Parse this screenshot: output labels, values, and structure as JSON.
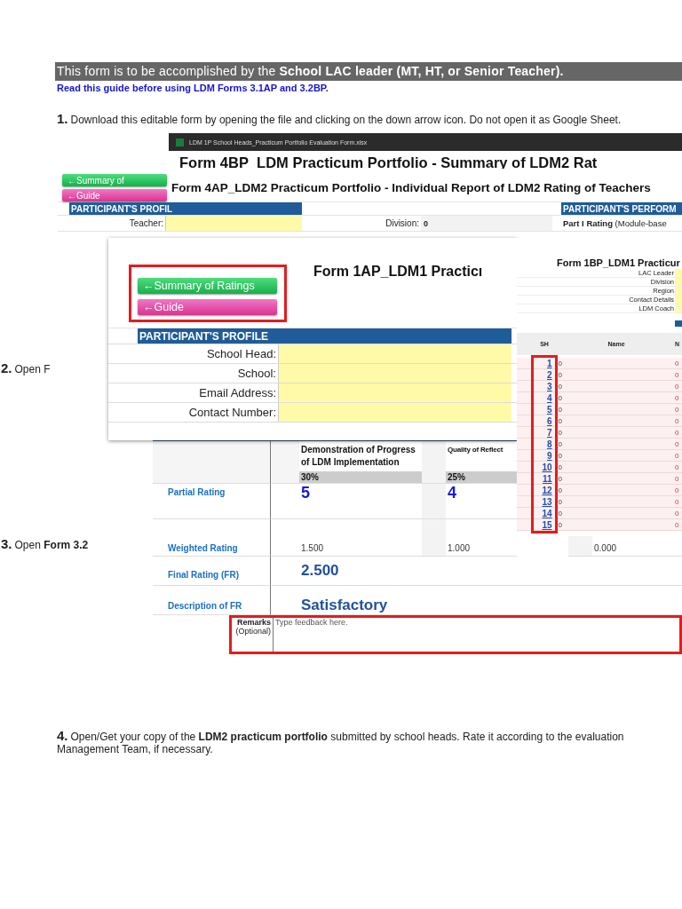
{
  "header": {
    "text": "This form is to be accomplished by the **School LAC leader (MT, HT, or Senior Teacher).**"
  },
  "guide_note": "Read this guide before using LDM Forms 3.1AP and 3.2BP.",
  "steps": [
    {
      "number": "1.",
      "text": "Download this editable form by opening the file and clicking on the down arrow icon. Do not open it as Google Sheet."
    },
    {
      "number": "2.",
      "text": "Open F"
    },
    {
      "number": "3.",
      "text": "Open **Form 3.2**"
    },
    {
      "number": "4.",
      "text": "Open/Get your copy of the **LDM2 practicum portfolio** submitted by school heads. Rate it according to the evaluation Management Team, if necessary."
    }
  ],
  "excel_window": {
    "file_name": "LDM 1P School Heads_Practicum Portfolio Evaluation Form.xlsx",
    "title": "Form 4BP_LDM Practicum Portfolio - Summary of LDM2 Rat"
  },
  "form_4ap": {
    "buttons": [
      {
        "label": "←Summary of",
        "kind": "summary"
      },
      {
        "label": "←Guide",
        "kind": "guide"
      }
    ],
    "title": "Form 4AP_LDM2 Practicum Portfolio - Individual Report of LDM2 Rating of Teachers",
    "profile_header": "PARTICIPANT'S PROFIL",
    "performance_header": "PARTICIPANT'S PERFORM",
    "rows": [
      {
        "label": "Teacher:",
        "info_label": "Division:",
        "info_value": "0",
        "performance": "**Part I Rating** (Module-base"
      }
    ]
  },
  "form_1ap": {
    "buttons": [
      {
        "label": "←Summary of Ratings",
        "kind": "summary"
      },
      {
        "label": "←Guide",
        "kind": "guide"
      }
    ],
    "title": "Form 1AP_LDM1 Practicı",
    "profile_header": "PARTICIPANT'S PROFILE",
    "fields": [
      {
        "label": "School Head:"
      },
      {
        "label": "School:"
      },
      {
        "label": "Email Address:"
      },
      {
        "label": "Contact Number:"
      }
    ]
  },
  "rating_sheet": {
    "criteria": [
      {
        "title": "Demonstration of Progress of LDM Implementation",
        "weight": "30%",
        "partial": "5",
        "weighted": "1.500"
      },
      {
        "title": "Quality of Reflect",
        "weight": "25%",
        "partial": "4",
        "weighted": "1.000"
      },
      {
        "weighted": "0.000"
      }
    ],
    "labels": {
      "partial": "Partial Rating",
      "weighted": "Weighted Rating",
      "final": "Final Rating (FR)",
      "description": "Description of FR"
    },
    "final_rating": "2.500",
    "description": "Satisfactory",
    "remarks": {
      "label": "Remarks",
      "note": "(Optional)",
      "placeholder": "Type feedback here."
    }
  },
  "form_1bp": {
    "title": "Form 1BP_LDM1 Practicur",
    "fields": [
      "LAC Leader",
      "Division",
      "Region",
      "Contact Details",
      "LDM  Coach"
    ],
    "columns": [
      "SH",
      "Name",
      "N"
    ],
    "rows": [
      {
        "sh": "1",
        "name": "0",
        "column_3": "0"
      },
      {
        "sh": "2",
        "name": "0",
        "column_3": "0"
      },
      {
        "sh": "3",
        "name": "0",
        "column_3": "0"
      },
      {
        "sh": "4",
        "name": "0",
        "column_3": "0"
      },
      {
        "sh": "5",
        "name": "0",
        "column_3": "0"
      },
      {
        "sh": "6",
        "name": "0",
        "column_3": "0"
      },
      {
        "sh": "7",
        "name": "0",
        "column_3": "0"
      },
      {
        "sh": "8",
        "name": "0",
        "column_3": "0"
      },
      {
        "sh": "9",
        "name": "0",
        "column_3": "0"
      },
      {
        "sh": "10",
        "name": "0",
        "column_3": "0"
      },
      {
        "sh": "11",
        "name": "0",
        "column_3": "0"
      },
      {
        "sh": "12",
        "name": "0",
        "column_3": "0"
      },
      {
        "sh": "13",
        "name": "0",
        "column_3": "0"
      },
      {
        "sh": "14",
        "name": "0",
        "column_3": "0"
      },
      {
        "sh": "15",
        "name": "0",
        "column_3": "0"
      }
    ]
  }
}
